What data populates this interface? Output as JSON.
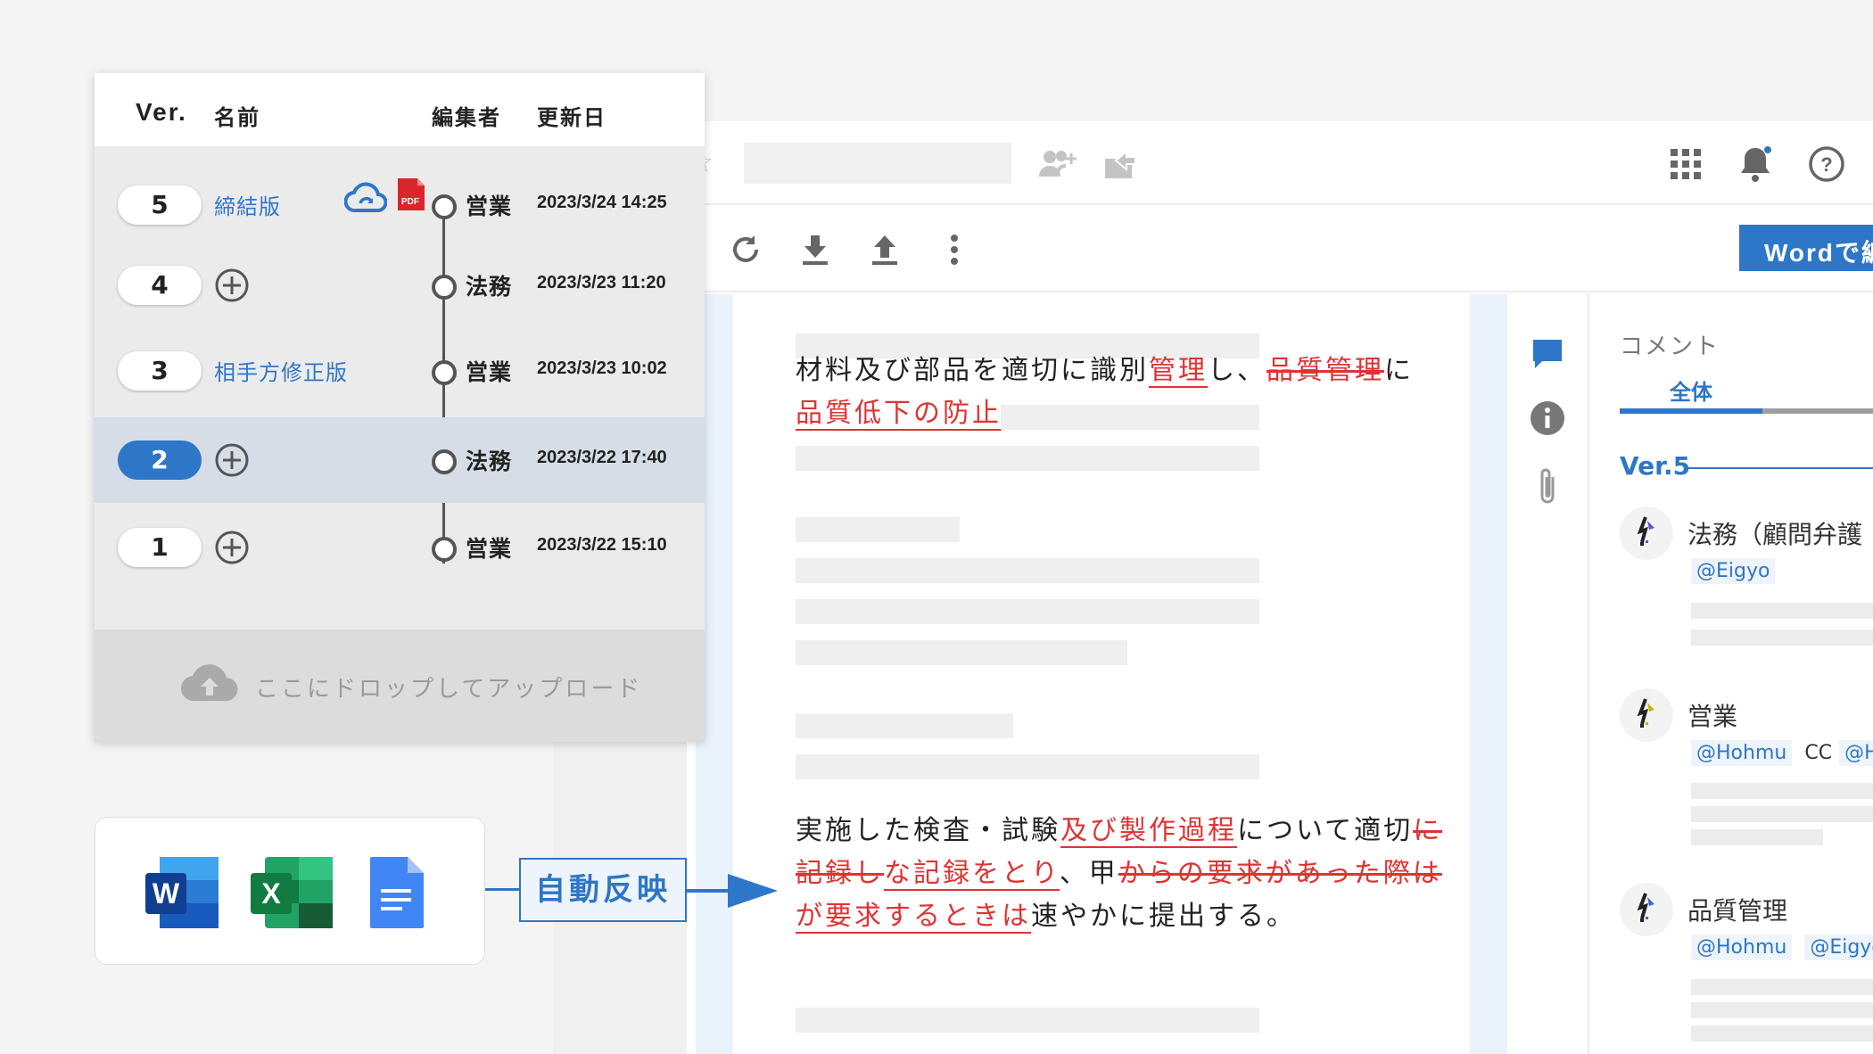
{
  "version_table": {
    "headers": {
      "ver": "Ver.",
      "name": "名前",
      "editor": "編集者",
      "date": "更新日"
    },
    "rows": [
      {
        "ver": "5",
        "name": "締結版",
        "editor": "営業",
        "date": "2023/3/24 14:25",
        "selected": false,
        "has_name": true,
        "icons": [
          "cloud-icon",
          "pdf-icon"
        ]
      },
      {
        "ver": "4",
        "name": "",
        "editor": "法務",
        "date": "2023/3/23 11:20",
        "selected": false,
        "has_name": false
      },
      {
        "ver": "3",
        "name": "相手方修正版",
        "editor": "営業",
        "date": "2023/3/23 10:02",
        "selected": false,
        "has_name": true
      },
      {
        "ver": "2",
        "name": "",
        "editor": "法務",
        "date": "2023/3/22 17:40",
        "selected": true,
        "has_name": false
      },
      {
        "ver": "1",
        "name": "",
        "editor": "営業",
        "date": "2023/3/22 15:10",
        "selected": false,
        "has_name": false
      }
    ],
    "drop_zone": "ここにドロップしてアップロード"
  },
  "apps": {
    "items": [
      "word-icon",
      "excel-icon",
      "google-docs-icon"
    ],
    "auto_label": "自動反映"
  },
  "toolbar": {
    "word_button": "Wordで編"
  },
  "document": {
    "para1_a": "材料及び部品を適切に識別",
    "para1_ins1": "管理",
    "para1_b": "し、",
    "para1_del1": "品質管理",
    "para1_c": "に",
    "para1_ins2": "品質低下の防止",
    "para2_a": "実施した検査・試験",
    "para2_ins1": "及び製作過程",
    "para2_b": "について適切",
    "para2_del1": "に",
    "para2_del2": "記録し",
    "para2_ins2": "な記録をとり",
    "para2_c": "、甲",
    "para2_del3": "からの要求があった際は",
    "para2_ins3": "が要求するときは",
    "para2_d": "速やかに提出する。"
  },
  "comments_panel": {
    "title": "コメント",
    "tab_all": "全体",
    "version_heading": "Ver.5",
    "comments": [
      {
        "name": "法務（顧問弁護",
        "tags": [
          "@Eigyo"
        ],
        "cc": "",
        "cc_tags": []
      },
      {
        "name": "営業",
        "tags": [
          "@Hohmu"
        ],
        "cc": "CC",
        "cc_tags": [
          "@Hi"
        ]
      },
      {
        "name": "品質管理",
        "tags": [
          "@Hohmu",
          "@Eigyo"
        ],
        "cc": "",
        "cc_tags": []
      }
    ]
  },
  "colors": {
    "accent": "#2e76c8",
    "tracked_change": "#e03232",
    "selected_row": "#d6dde6"
  }
}
